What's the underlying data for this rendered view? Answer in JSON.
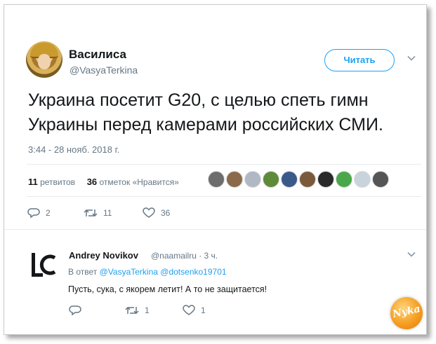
{
  "tweet": {
    "author_name": "Василиса",
    "author_handle": "@VasyaTerkina",
    "follow_label": "Читать",
    "text": "Украина посетит G20, с целью спеть гимн Украины перед камерами российских СМИ.",
    "timestamp": "3:44 - 28 нояб. 2018 г.",
    "retweets_count": "11",
    "retweets_label": "ретвитов",
    "likes_count": "36",
    "likes_label": "отметок «Нравится»",
    "actions": {
      "replies": "2",
      "retweets": "11",
      "likes": "36"
    }
  },
  "reply": {
    "author_name": "Andrey Novikov",
    "author_handle": "@naamailru",
    "time": "· 3 ч.",
    "in_reply_prefix": "В ответ",
    "mention_1": "@VasyaTerkina",
    "mention_2": "@dotsenko19701",
    "text": "Пусть, сука, с якорем летит! А то не защитается!",
    "actions": {
      "replies": "",
      "retweets": "1",
      "likes": "1"
    }
  },
  "watermark": {
    "text": "Nyka"
  },
  "colors": {
    "accent": "#1da1f2",
    "text": "#14171a",
    "muted": "#657786",
    "watermark": "#f39a1b"
  }
}
